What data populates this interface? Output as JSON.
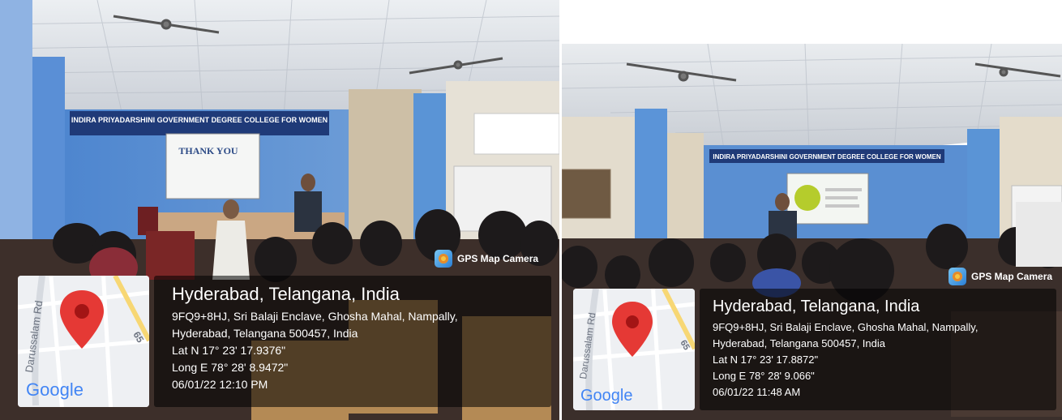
{
  "photos": [
    {
      "banner": "INDIRA PRIYADARSHINI GOVERNMENT DEGREE COLLEGE FOR WOMEN",
      "screen_text": "THANK YOU",
      "camera_label": "GPS Map Camera",
      "place": "Hyderabad, Telangana, India",
      "address_line1": "9FQ9+8HJ, Sri Balaji Enclave, Ghosha Mahal, Nampally,",
      "address_line2": "Hyderabad, Telangana 500457, India",
      "lat": "Lat N 17° 23' 17.9376\"",
      "long": "Long E 78° 28' 8.9472\"",
      "datetime": "06/01/22 12:10 PM",
      "map": {
        "road_label": "Darussalam Rd",
        "route_number": "65",
        "logo": "Google"
      }
    },
    {
      "banner": "INDIRA PRIYADARSHINI GOVERNMENT DEGREE COLLEGE FOR WOMEN",
      "camera_label": "GPS Map Camera",
      "place": "Hyderabad, Telangana, India",
      "address_line1": "9FQ9+8HJ, Sri Balaji Enclave, Ghosha Mahal, Nampally,",
      "address_line2": "Hyderabad, Telangana 500457, India",
      "lat": "Lat N 17° 23' 17.8872\"",
      "long": "Long E 78° 28' 9.066\"",
      "datetime": "06/01/22 11:48 AM",
      "map": {
        "road_label": "Darussalam Rd",
        "route_number": "65",
        "logo": "Google"
      }
    }
  ],
  "colors": {
    "wall": "#5b8fd0",
    "ceiling": "#d9dde3",
    "pin": "#e53935",
    "google_blue": "#4285f4"
  }
}
